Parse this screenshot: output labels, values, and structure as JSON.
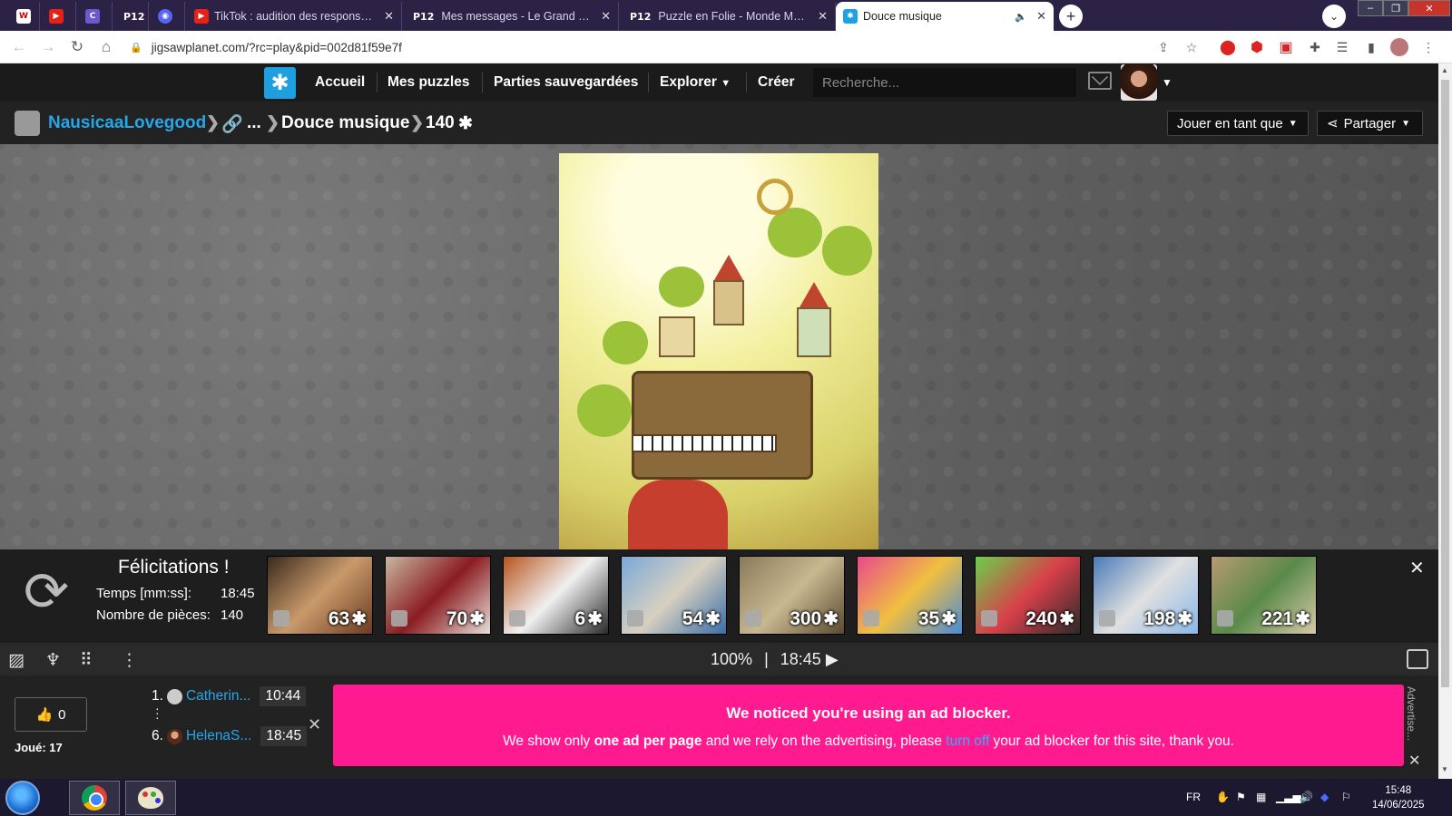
{
  "browser": {
    "tabs": [
      {
        "title": "",
        "favicon": "word-icon"
      },
      {
        "title": "",
        "favicon": "youtube-icon"
      },
      {
        "title": "",
        "favicon": "tweetdeck-icon"
      },
      {
        "title": "",
        "favicon": "p12-icon",
        "favicon_text": "P12"
      },
      {
        "title": "",
        "favicon": "discord-icon"
      },
      {
        "title": "TikTok : audition des responsable",
        "favicon": "youtube-icon"
      },
      {
        "title": "Mes messages - Le Grand Escalie",
        "favicon": "p12-icon",
        "favicon_text": "P12"
      },
      {
        "title": "Puzzle en Folie - Monde Moldu -",
        "favicon": "p12-icon",
        "favicon_text": "P12"
      },
      {
        "title": "Douce musique",
        "favicon": "jigsawplanet-icon",
        "active": true,
        "audio": true
      }
    ],
    "url": "jigsawplanet.com/?rc=play&pid=002d81f59e7f"
  },
  "site": {
    "nav": {
      "home": "Accueil",
      "my_puzzles": "Mes puzzles",
      "saved_games": "Parties sauvegardées",
      "explore": "Explorer",
      "create": "Créer"
    },
    "search_placeholder": "Recherche..."
  },
  "breadcrumb": {
    "user": "NausicaaLovegood",
    "ellipsis": "...",
    "puzzle_title": "Douce musique",
    "pieces": "140",
    "play_as": "Jouer en tant que",
    "share": "Partager"
  },
  "completion": {
    "title": "Félicitations !",
    "time_label": "Temps [mm:ss]:",
    "time_value": "18:45",
    "pieces_label": "Nombre de pièces:",
    "pieces_value": "140",
    "suggestions": [
      {
        "count": "63",
        "colors": [
          "#3a2a1c",
          "#c99a6a",
          "#6b3b22"
        ]
      },
      {
        "count": "70",
        "colors": [
          "#c9b7a0",
          "#8a1c22",
          "#e8e0d8"
        ]
      },
      {
        "count": "6",
        "colors": [
          "#b8541e",
          "#f0f0f0",
          "#2a2a2a"
        ]
      },
      {
        "count": "54",
        "colors": [
          "#7aa8d8",
          "#d8d0c0",
          "#3a6ea8"
        ]
      },
      {
        "count": "300",
        "colors": [
          "#8a7a5a",
          "#c8b890",
          "#5a4a30"
        ]
      },
      {
        "count": "35",
        "colors": [
          "#e84a8a",
          "#f0c040",
          "#4a8ad8"
        ]
      },
      {
        "count": "240",
        "colors": [
          "#6ad04a",
          "#d8404a",
          "#2a2a2a"
        ]
      },
      {
        "count": "198",
        "colors": [
          "#4a7ab8",
          "#e0e0e0",
          "#8ab8e8"
        ]
      },
      {
        "count": "221",
        "colors": [
          "#b89a70",
          "#5a8a4a",
          "#d8c8a8"
        ]
      }
    ]
  },
  "puzzle_toolbar": {
    "zoom": "100%",
    "separator": "|",
    "timer": "18:45"
  },
  "leaderboard": {
    "likes": "0",
    "played_label": "Joué: 17",
    "entries": [
      {
        "rank": "1.",
        "name": "Catherin...",
        "time": "10:44"
      },
      {
        "rank": "6.",
        "name": "HelenaS...",
        "time": "18:45"
      }
    ]
  },
  "ad_notice": {
    "heading": "We noticed you're using an ad blocker.",
    "text_1": "We show only ",
    "bold": "one ad per page",
    "text_2": " and we rely on the advertising, please ",
    "link": "turn off",
    "text_3": " your ad blocker for this site, thank you.",
    "side_label": "Advertise..."
  },
  "taskbar": {
    "language": "FR",
    "time": "15:48",
    "date": "14/06/2025"
  },
  "colors": {
    "accent_blue": "#27a6e7",
    "ad_pink": "#ff1a8f",
    "header_bg": "#1b1b1b",
    "tabstrip_bg": "#2b2246"
  }
}
